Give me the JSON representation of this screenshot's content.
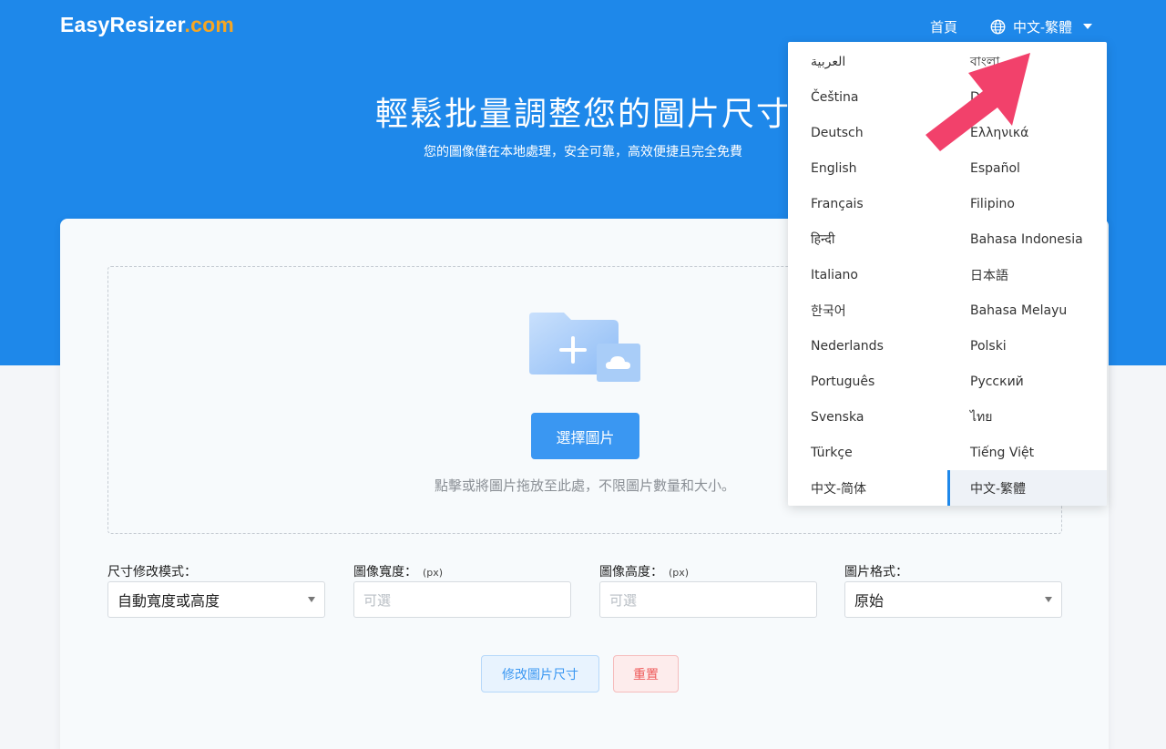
{
  "header": {
    "logo_main": "EasyResizer",
    "logo_suffix": ".com",
    "nav_home": "首頁",
    "language_current": "中文-繁體"
  },
  "hero": {
    "title": "輕鬆批量調整您的圖片尺寸",
    "subtitle": "您的圖像僅在本地處理，安全可靠，高效便捷且完全免費"
  },
  "dropzone": {
    "select_button": "選擇圖片",
    "hint": "點擊或將圖片拖放至此處，不限圖片數量和大小。"
  },
  "form": {
    "mode_label": "尺寸修改模式：",
    "mode_value": "自動寬度或高度",
    "width_label": "圖像寬度：",
    "width_unit": "(px)",
    "width_placeholder": "可選",
    "height_label": "圖像高度：",
    "height_unit": "(px)",
    "height_placeholder": "可選",
    "format_label": "圖片格式：",
    "format_value": "原始"
  },
  "actions": {
    "resize": "修改圖片尺寸",
    "reset": "重置"
  },
  "language_menu": {
    "items": [
      "العربية",
      "বাংলা",
      "Čeština",
      "Dansk",
      "Deutsch",
      "Ελληνικά",
      "English",
      "Español",
      "Français",
      "Filipino",
      "हिन्दी",
      "Bahasa Indonesia",
      "Italiano",
      "日本語",
      "한국어",
      "Bahasa Melayu",
      "Nederlands",
      "Polski",
      "Português",
      "Русский",
      "Svenska",
      "ไทย",
      "Türkçe",
      "Tiếng Việt",
      "中文-简体",
      "中文-繁體"
    ],
    "active": "中文-繁體"
  },
  "colors": {
    "hero_bg": "#1e88ea",
    "logo_accent": "#f5a623",
    "primary_button": "#3a97f2",
    "reset_text": "#ee5a5a",
    "annotation_arrow": "#f2416b"
  }
}
